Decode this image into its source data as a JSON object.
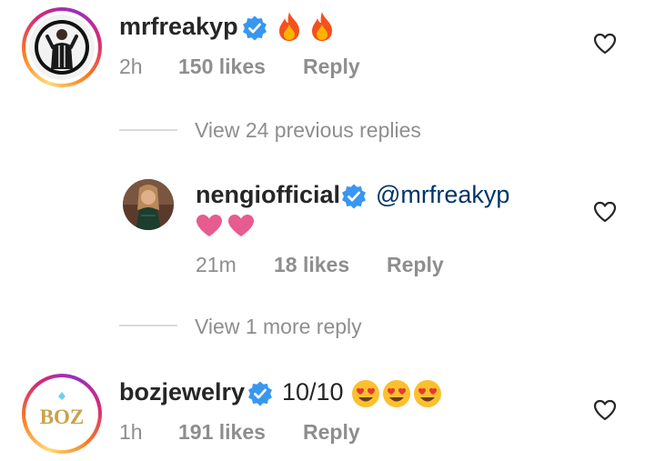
{
  "comments": [
    {
      "username": "mrfreakyp",
      "time": "2h",
      "likes": "150 likes",
      "reply": "Reply"
    },
    {
      "username": "nengiofficial",
      "mention": "@mrfreakyp",
      "time": "21m",
      "likes": "18 likes",
      "reply": "Reply"
    },
    {
      "username": "bozjewelry",
      "text": "10/10",
      "logo_text": "BOZ",
      "time": "1h",
      "likes": "191 likes",
      "reply": "Reply"
    }
  ],
  "threads": {
    "view_previous": "View 24 previous replies",
    "view_more": "View 1 more reply"
  },
  "icons": {
    "verified": "verified-badge-icon",
    "like": "heart-outline-icon",
    "fire": "fire-emoji",
    "pink_heart": "pink-heart-emoji",
    "heart_eyes": "heart-eyes-emoji"
  },
  "colors": {
    "verified_blue": "#3897f0",
    "mention": "#003569",
    "muted": "#8e8e8e",
    "pink_heart": "#e75c8f"
  }
}
